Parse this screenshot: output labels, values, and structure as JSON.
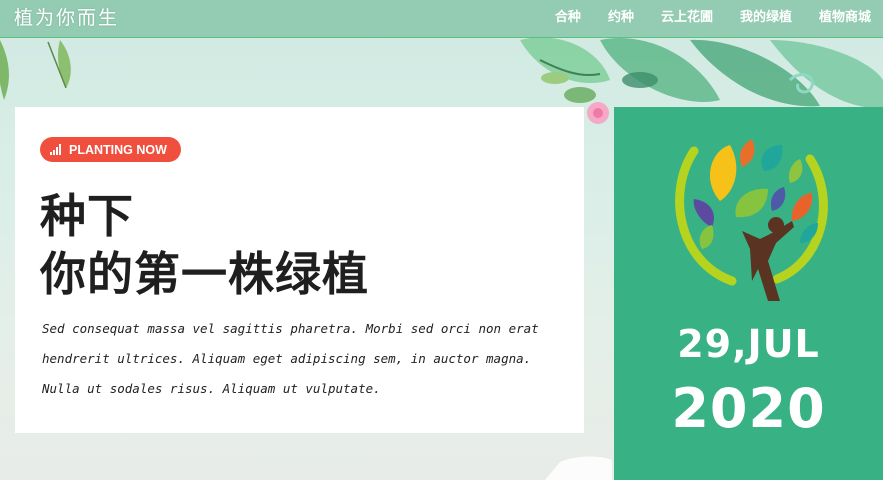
{
  "header": {
    "brand": "植为你而生",
    "nav": [
      "合种",
      "约种",
      "云上花圃",
      "我的绿植",
      "植物商城"
    ]
  },
  "card": {
    "badge": "PLANTING NOW",
    "headline_line1": "种下",
    "headline_line2": "你的第一株绿植",
    "description": "Sed consequat massa vel sagittis pharetra. Morbi sed orci non erat hendrerit ultrices. Aliquam eget adipiscing sem, in auctor magna. Nulla ut sodales risus. Aliquam ut vulputate."
  },
  "date": {
    "day": "29,JUL",
    "year": "2020"
  },
  "colors": {
    "accent_green": "#38b285",
    "badge_red": "#ef4f3c",
    "header_green": "#82c3a5"
  },
  "icons": {
    "badge_icon": "signal-bars-icon",
    "logo": "tree-person-logo"
  }
}
